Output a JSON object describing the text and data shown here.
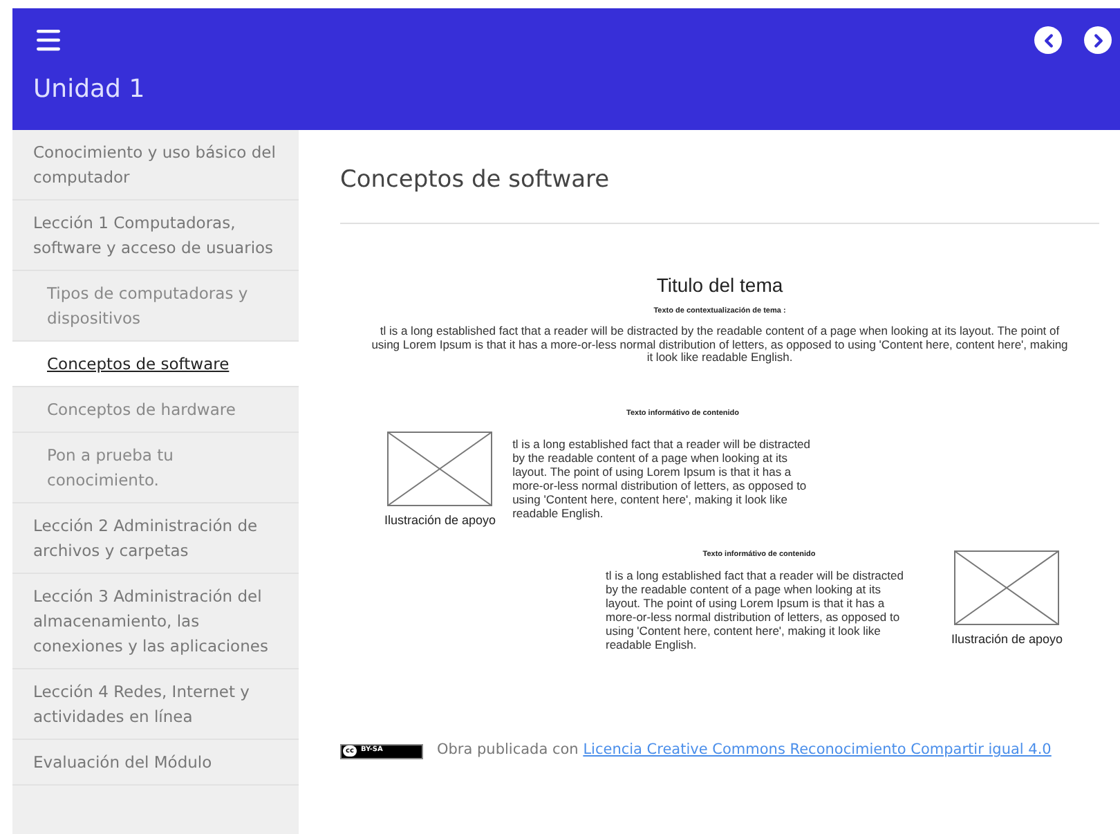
{
  "header": {
    "title": "Unidad 1"
  },
  "sidebar": {
    "items": [
      {
        "label": "Conocimiento y uso básico del computador",
        "selected": false
      },
      {
        "label": "Lección 1 Computadoras, software y acceso de usuarios",
        "selected": false,
        "children": [
          {
            "label": "Tipos de computadoras y dispositivos",
            "selected": false
          },
          {
            "label": "Conceptos de software",
            "selected": true
          },
          {
            "label": "Conceptos de hardware",
            "selected": false
          },
          {
            "label": "Pon a prueba tu conocimiento.",
            "selected": false
          }
        ]
      },
      {
        "label": "Lección 2 Administración de archivos y carpetas",
        "selected": false
      },
      {
        "label": "Lección 3 Administración del almacenamiento, las conexiones y las aplicaciones",
        "selected": false
      },
      {
        "label": "Lección 4 Redes, Internet y actividades en línea",
        "selected": false
      },
      {
        "label": "Evaluación del Módulo",
        "selected": false
      }
    ]
  },
  "page_title": "Conceptos de software",
  "document": {
    "title": "Titulo del tema",
    "subtitle": "Texto de contextualización de tema :",
    "intro": "tl is a long established fact that a reader will be distracted by the readable content of a page when looking at its layout. The point of using Lorem Ipsum is that it has a more-or-less normal distribution of letters, as opposed to using 'Content here, content here', making it look like readable English.",
    "sections": [
      {
        "kind": "image-left",
        "heading": "Texto informátivo de contenido",
        "body": "tl is a long established fact that a reader will be distracted by the readable content of a page when looking at its layout. The point of using Lorem Ipsum is that it has a more-or-less normal distribution of letters, as opposed to using 'Content here, content here', making it look like readable English.",
        "caption": "Ilustración de apoyo"
      },
      {
        "kind": "image-right",
        "heading": "Texto informátivo de contenido",
        "body": "tl is a long established fact that a reader will be distracted by the readable content of a page when looking at its layout. The point of using Lorem Ipsum is that it has a more-or-less normal distribution of letters, as opposed to using 'Content here, content here', making it look like readable English.",
        "caption": "Ilustración de apoyo"
      }
    ]
  },
  "footer": {
    "badge": {
      "mark": "cc",
      "label": "BY-SA"
    },
    "text": "Obra publicada con",
    "link": "Licencia Creative Commons Reconocimiento Compartir igual 4.0"
  }
}
